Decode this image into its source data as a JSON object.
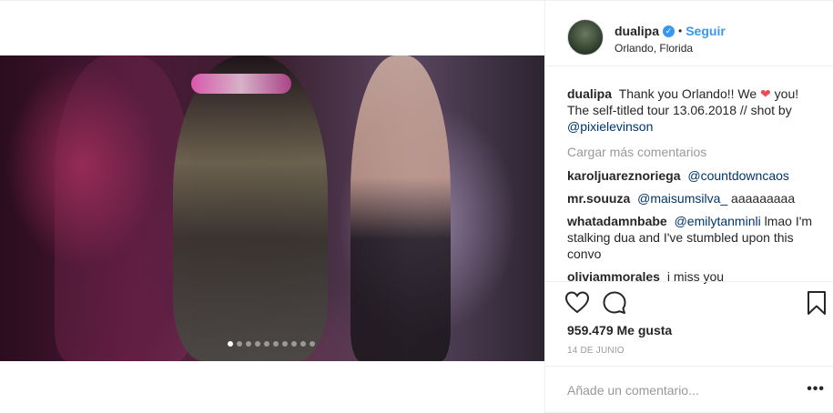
{
  "post": {
    "username": "dualipa",
    "separator": "•",
    "follow_label": "Seguir",
    "location": "Orlando, Florida",
    "carousel": {
      "count": 10,
      "active_index": 0
    },
    "caption": {
      "user": "dualipa",
      "text_before_heart": "Thank you Orlando!! We",
      "heart": "❤",
      "text_after_heart": "you! The self-titled tour 13.06.2018 // shot by",
      "mention": "@pixielevinson"
    },
    "load_more_label": "Cargar más comentarios",
    "comments": [
      {
        "user": "karoljuareznoriega",
        "mention": "@countdowncaos",
        "text": ""
      },
      {
        "user": "mr.souuza",
        "mention": "@maisumsilva_",
        "text": "aaaaaaaaa"
      },
      {
        "user": "whatadamnbabe",
        "mention": "@emilytanminli",
        "text": "lmao I'm stalking dua and I've stumbled upon this convo"
      },
      {
        "user": "oliviammorales",
        "mention": "",
        "text": "i miss you"
      }
    ],
    "likes_text": "959.479 Me gusta",
    "date_text": "14 DE JUNIO",
    "add_comment_placeholder": "Añade un comentario...",
    "more_options": "•••",
    "icons": {
      "like": "heart-outline-icon",
      "comment": "speech-bubble-icon",
      "save": "bookmark-icon",
      "verified": "verified-badge-icon"
    },
    "colors": {
      "accent": "#3897f0",
      "mention": "#003569",
      "muted": "#999999",
      "text": "#262626",
      "heart": "#ed4956",
      "border": "#efefef"
    }
  }
}
